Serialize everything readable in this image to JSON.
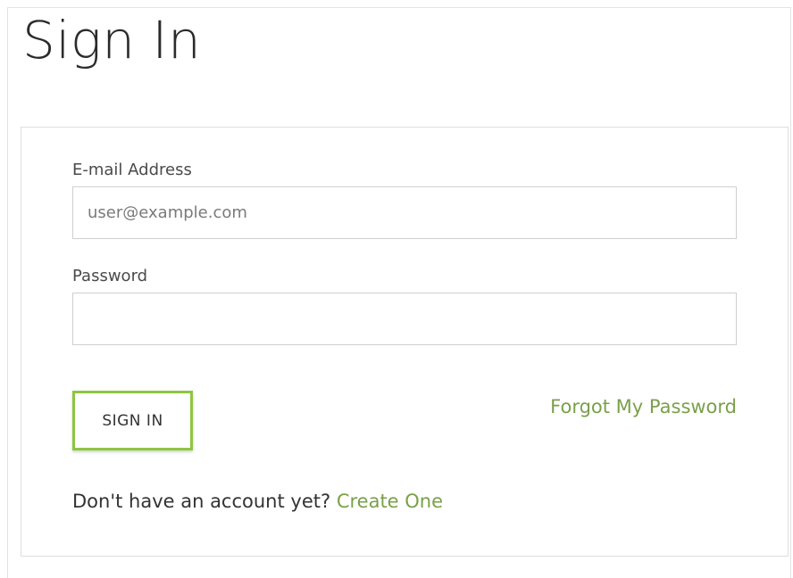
{
  "page": {
    "title": "Sign In"
  },
  "form": {
    "email_label": "E-mail Address",
    "email_placeholder": "user@example.com",
    "email_value": "",
    "password_label": "Password",
    "password_value": "",
    "submit_label": "SIGN IN",
    "forgot_password_label": "Forgot My Password",
    "no_account_text": "Don't have an account yet?",
    "create_account_label": "Create One"
  },
  "colors": {
    "accent": "#8dc63f",
    "link": "#7aa04a",
    "text": "#333333",
    "border": "#cfcfcf"
  }
}
